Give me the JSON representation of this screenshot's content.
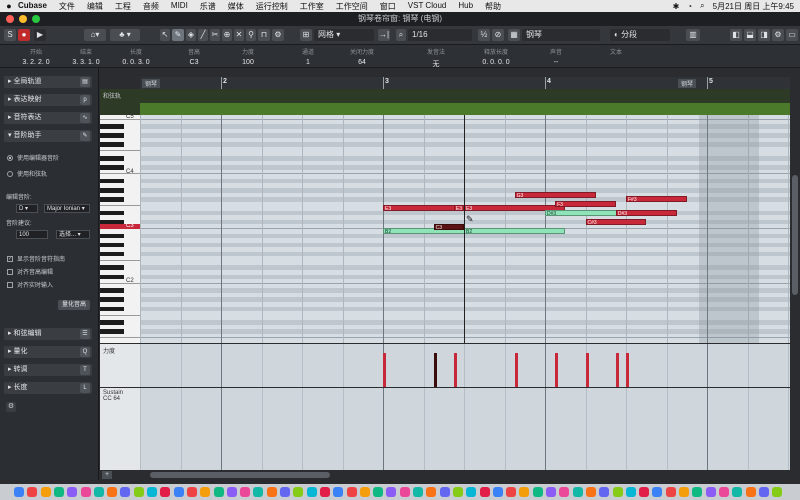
{
  "menu": {
    "apple": "",
    "items": [
      "Cubase",
      "文件",
      "编辑",
      "工程",
      "音频",
      "MIDI",
      "乐谱",
      "媒体",
      "运行控制",
      "工作室",
      "工作空间",
      "窗口",
      "VST Cloud",
      "Hub",
      "帮助"
    ],
    "clock": "5月21日 周日 上午9:45"
  },
  "window": {
    "title": "钢琴卷帘窗: 钢琴 (电钢)"
  },
  "toolbar": {
    "snap_type": "网格",
    "quantize": "1/16",
    "track": "钢琴",
    "segment": "分段"
  },
  "infoline": {
    "columns": [
      {
        "h": "开始",
        "v": "3. 2. 2. 0"
      },
      {
        "h": "结束",
        "v": "3. 3. 1. 0"
      },
      {
        "h": "长度",
        "v": "0. 0. 3. 0"
      },
      {
        "h": "音高",
        "v": "C3"
      },
      {
        "h": "力度",
        "v": "100"
      },
      {
        "h": "通道",
        "v": "1"
      },
      {
        "h": "关闭力度",
        "v": "64"
      },
      {
        "h": "发音法",
        "v": "无"
      },
      {
        "h": "释放长度",
        "v": "0. 0. 0. 0"
      },
      {
        "h": "声音",
        "v": "--"
      },
      {
        "h": "文本",
        "v": ""
      }
    ]
  },
  "inspector": {
    "sections": [
      "全局轨道",
      "表达映射",
      "音符表达",
      "音阶助手"
    ],
    "radio1": "使用编辑器音阶",
    "radio2": "使用和弦轨",
    "scale_label": "编辑音阶:",
    "scale_root": "D",
    "scale_type": "Major Ionian",
    "suggest_label": "音阶建议:",
    "suggest_value": "100",
    "select_label": "选择...",
    "check1": "显示音阶音符指南",
    "check2": "对齐音高编辑",
    "check3": "对齐实时输入",
    "quantize_pitch": "量化音高",
    "bottom_sections": [
      "和弦编辑",
      "量化",
      "转调",
      "长度"
    ]
  },
  "ruler": {
    "marks": [
      "2",
      "3",
      "4",
      "5"
    ],
    "track_tag": "钢琴"
  },
  "chordtrack": {
    "label": "和弦轨"
  },
  "keyboard": {
    "labels": [
      "C5",
      "C4",
      "C3",
      "C2"
    ]
  },
  "lanes": {
    "velocity": "力度",
    "cc_line1": "Sustain",
    "cc_line2": "CC 64"
  },
  "notes": [
    {
      "name": "E3",
      "start": 3.0,
      "len": 0.625,
      "pitch": 52,
      "color": "#c7283a"
    },
    {
      "name": "B2",
      "start": 3.0,
      "len": 0.625,
      "pitch": 47,
      "color": "#8fe3b8"
    },
    {
      "name": "C3",
      "start": 3.3125,
      "len": 0.1875,
      "pitch": 48,
      "color": "#5a1212"
    },
    {
      "name": "E3",
      "start": 3.4375,
      "len": 0.0625,
      "pitch": 52,
      "color": "#c7283a"
    },
    {
      "name": "E3",
      "start": 3.5,
      "len": 0.625,
      "pitch": 52,
      "color": "#c7283a"
    },
    {
      "name": "B2",
      "start": 3.5,
      "len": 0.625,
      "pitch": 47,
      "color": "#8fe3b8"
    },
    {
      "name": "G3",
      "start": 3.8125,
      "len": 0.5,
      "pitch": 55,
      "color": "#c7283a"
    },
    {
      "name": "F3",
      "start": 4.0625,
      "len": 0.375,
      "pitch": 53,
      "color": "#c7283a"
    },
    {
      "name": "D#3",
      "start": 4.0,
      "len": 0.5,
      "pitch": 51,
      "color": "#8fe3b8"
    },
    {
      "name": "C#3",
      "start": 4.25,
      "len": 0.375,
      "pitch": 49,
      "color": "#c7283a"
    },
    {
      "name": "D#3",
      "start": 4.4375,
      "len": 0.375,
      "pitch": 51,
      "color": "#c7283a"
    },
    {
      "name": "F#3",
      "start": 4.5,
      "len": 0.375,
      "pitch": 54,
      "color": "#c7283a"
    }
  ],
  "velocities": [
    3.0,
    3.3125,
    3.4375,
    3.8125,
    4.0625,
    4.25,
    4.4375,
    4.5
  ]
}
